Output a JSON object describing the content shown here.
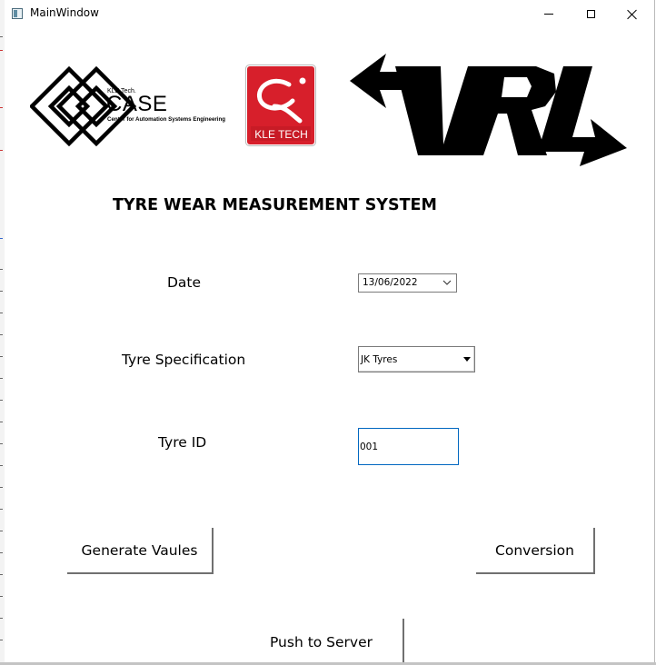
{
  "window": {
    "title": "MainWindow",
    "controls": [
      "minimize-icon",
      "maximize-icon",
      "close-icon"
    ]
  },
  "logos": {
    "case": {
      "small": "KLE Tech.",
      "big": "CASE",
      "sub": "Center for Automation Systems Engineering"
    },
    "kle": {
      "caption": "KLE TECH",
      "color": "#d71f2b"
    },
    "vrl": {
      "text": "VRL"
    }
  },
  "main": {
    "title": "TYRE WEAR MEASUREMENT SYSTEM",
    "date": {
      "label": "Date",
      "value": "13/06/2022"
    },
    "spec": {
      "label": "Tyre Specification",
      "value": "JK Tyres"
    },
    "tyre_id": {
      "label": "Tyre ID",
      "value": "001"
    }
  },
  "buttons": {
    "generate": "Generate Vaules",
    "conversion": "Conversion",
    "push": "Push to Server"
  },
  "colors": {
    "focus_border": "#0067c0",
    "kle_red": "#d71f2b"
  }
}
